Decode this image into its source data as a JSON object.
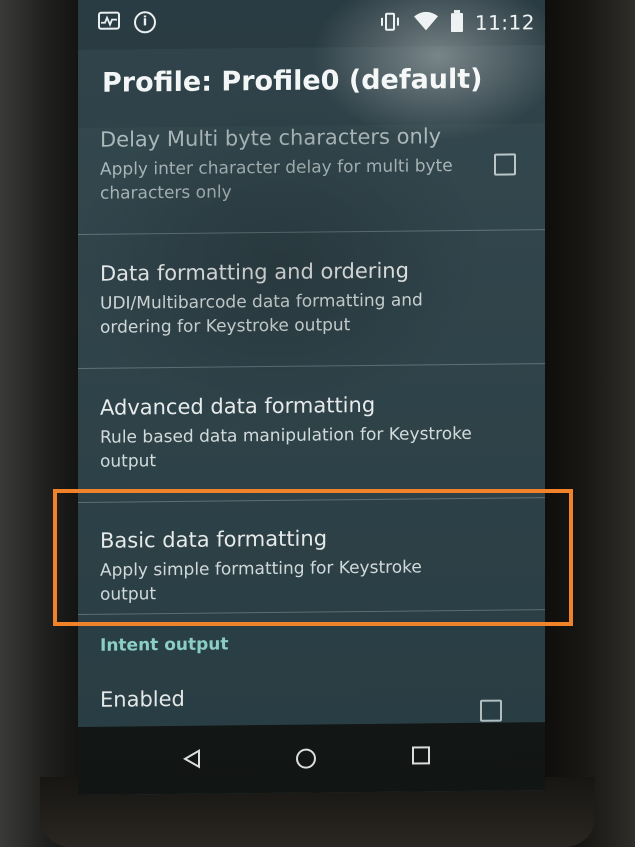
{
  "status_bar": {
    "time": "11:12",
    "left_icons": [
      "pulse-monitor-icon",
      "info-icon"
    ],
    "right_icons": [
      "vibrate-icon",
      "wifi-icon",
      "battery-icon"
    ]
  },
  "app_bar": {
    "title": "Profile: Profile0 (default)"
  },
  "list": {
    "items": [
      {
        "title": "Delay Multi byte characters only",
        "summary": "Apply inter character delay for multi byte characters only",
        "has_checkbox": true,
        "checked": false
      },
      {
        "title": "Data formatting and ordering",
        "summary": "UDI/Multibarcode data formatting and ordering for Keystroke output"
      },
      {
        "title": "Advanced data formatting",
        "summary": "Rule based data manipulation for Keystroke output"
      },
      {
        "title": "Basic data formatting",
        "summary": "Apply simple formatting for Keystroke output"
      }
    ],
    "category": "Intent output",
    "enabled_item": {
      "title": "Enabled",
      "checked": false
    }
  },
  "nav_bar": {
    "buttons": [
      "back-icon",
      "home-icon",
      "recents-icon"
    ]
  },
  "colors": {
    "highlight": "#f0822a",
    "category_accent": "#8fd6ce",
    "screen_background": "#2a3f46"
  }
}
